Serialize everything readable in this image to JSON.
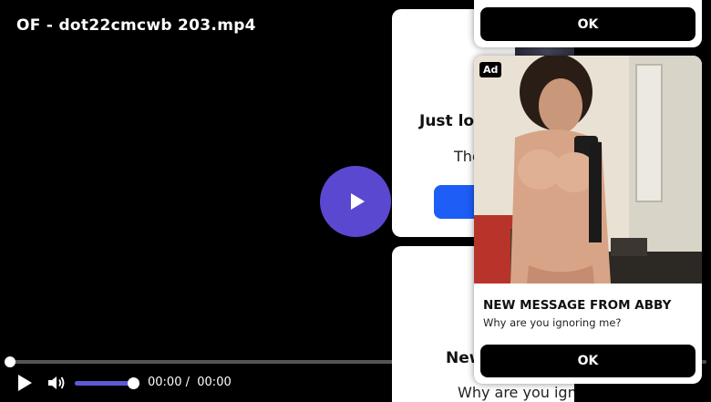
{
  "player": {
    "title": "OF - dot22cmcwb 203.mp4",
    "current_time": "00:00",
    "separator": "/",
    "duration": "00:00",
    "progress_fraction": 0.0,
    "volume_fraction": 1.0,
    "accent_color": "#5b48d0",
    "icons": {
      "big_play": "play-icon",
      "play": "play-icon",
      "volume": "volume-icon"
    }
  },
  "background_cards": [
    {
      "heading": "Just loo",
      "text": "The",
      "button_color": "#1e5ef7"
    },
    {
      "heading": "New",
      "text": "Why are you ignoring me?"
    }
  ],
  "ad_popups": {
    "top": {
      "ok_label": "OK"
    },
    "main": {
      "badge": "Ad",
      "title": "NEW MESSAGE FROM ABBY",
      "message": "Why are you ignoring me?",
      "ok_label": "OK"
    }
  }
}
